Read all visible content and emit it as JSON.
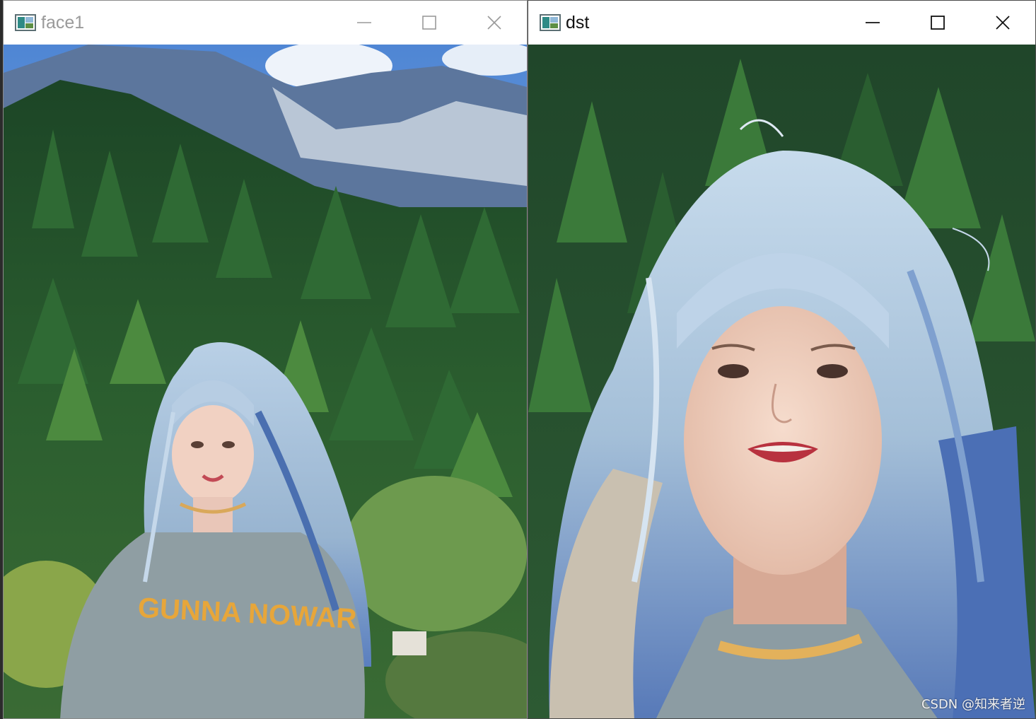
{
  "windows": [
    {
      "title": "face1",
      "state": "inactive",
      "controls": {
        "minimize": "minimize-icon",
        "maximize": "maximize-icon",
        "close": "close-icon"
      },
      "image": {
        "description_icon": "photo",
        "shirt_text": "GUNNA NOWAR"
      }
    },
    {
      "title": "dst",
      "state": "active",
      "controls": {
        "minimize": "minimize-icon",
        "maximize": "maximize-icon",
        "close": "close-icon"
      }
    }
  ],
  "watermark": "CSDN @知来者逆",
  "colors": {
    "sky": "#6f9fd8",
    "mountain": "#5b7399",
    "forest_dark": "#1f4a2a",
    "forest_light": "#3f7a3a",
    "hair": "#a7c2dc",
    "hair_dark": "#4a6fb0",
    "skin": "#f1d1c2",
    "shirt": "#8f9ea3",
    "shirt_text": "#e7a63a"
  }
}
